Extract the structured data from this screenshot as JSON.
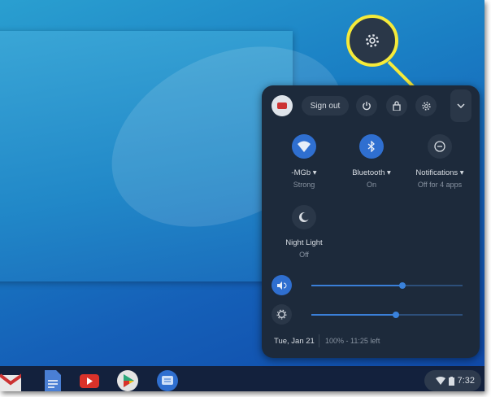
{
  "header": {
    "sign_out_label": "Sign out"
  },
  "tiles": [
    {
      "label": "-MGb",
      "sub": "Strong",
      "icon": "wifi-icon",
      "active": true
    },
    {
      "label": "Bluetooth",
      "sub": "On",
      "icon": "bluetooth-icon",
      "active": true
    },
    {
      "label": "Notifications",
      "sub": "Off for 4 apps",
      "icon": "do-not-disturb-icon",
      "active": false
    },
    {
      "label": "Night Light",
      "sub": "Off",
      "icon": "night-light-icon",
      "active": false
    }
  ],
  "sliders": {
    "volume": 0.6,
    "brightness": 0.56
  },
  "footer": {
    "date": "Tue, Jan 21",
    "battery": "100% - 11:25 left"
  },
  "tray": {
    "time": "7:32"
  },
  "colors": {
    "accent": "#2f6fd0",
    "callout": "#f5ea3a",
    "panel": "#1d2a3b"
  }
}
